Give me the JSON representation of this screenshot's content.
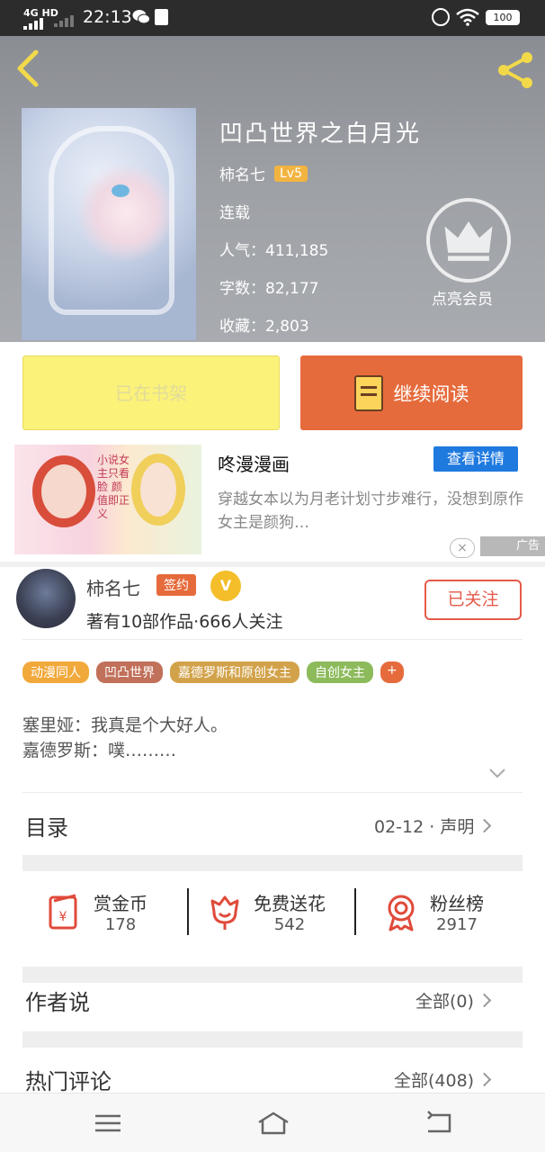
{
  "status_bar": {
    "network": "4G HD",
    "time": "22:13",
    "battery": "100"
  },
  "book": {
    "title": "凹凸世界之白月光",
    "author": "柿名七",
    "level": "Lv5",
    "status": "连载",
    "popularity": "人气：411,185",
    "word_count": "字数：82,177",
    "favorites": "收藏：2,803",
    "vip_label": "点亮会员"
  },
  "actions": {
    "shelf_label": "已在书架",
    "read_label": "继续阅读"
  },
  "ad": {
    "image_text": "小说女主只看脸 颜值即正义",
    "title": "咚漫漫画",
    "detail_button": "查看详情",
    "description": "穿越女本以为月老计划寸步难行，没想到原作女主是颜狗…",
    "close_icon": "×",
    "tag": "广告"
  },
  "author": {
    "name": "柿名七",
    "signed_badge": "签约",
    "v_badge": "V",
    "stats": "著有10部作品·666人关注",
    "follow_button": "已关注"
  },
  "tags": [
    {
      "label": "动漫同人",
      "color": "#f2a93b"
    },
    {
      "label": "凹凸世界",
      "color": "#c1705a"
    },
    {
      "label": "嘉德罗斯和原创女主",
      "color": "#d2a24a"
    },
    {
      "label": "自创女主",
      "color": "#8dbb5c"
    },
    {
      "label": "+",
      "color": "#e66b3c"
    }
  ],
  "description": {
    "line1": "塞里娅：我真是个大好人。",
    "line2": "嘉德罗斯：噗………"
  },
  "catalog": {
    "label": "目录",
    "latest": "02-12 · 声明"
  },
  "stats": [
    {
      "label": "赏金币",
      "value": "178",
      "icon": "red-envelope-icon"
    },
    {
      "label": "免费送花",
      "value": "542",
      "icon": "flower-icon"
    },
    {
      "label": "粉丝榜",
      "value": "2917",
      "icon": "medal-icon"
    }
  ],
  "author_says": {
    "label": "作者说",
    "all": "全部(0)"
  },
  "hot_comments": {
    "label": "热门评论",
    "all": "全部(408)"
  }
}
